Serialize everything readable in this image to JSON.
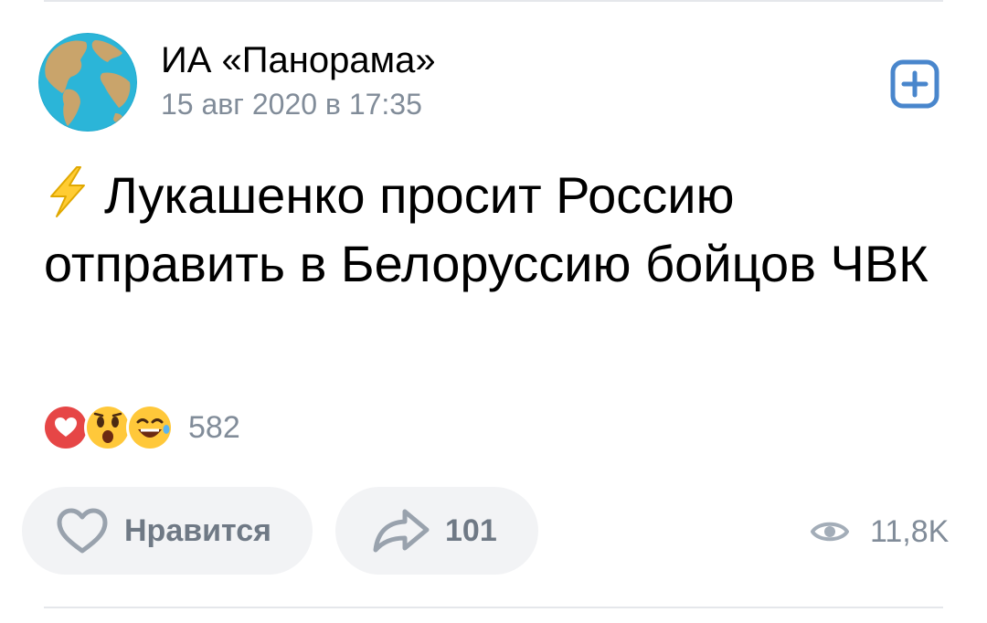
{
  "post": {
    "author": "ИА «Панорама»",
    "date": "15 авг 2020 в 17:35",
    "text": "Лукашенко просит Россию отправить в Белоруссию бойцов ЧВК",
    "text_prefix_icon": "lightning-icon"
  },
  "reactions": {
    "icons": [
      "heart-icon",
      "shocked-face-icon",
      "laughing-face-icon"
    ],
    "count": "582"
  },
  "actions": {
    "like_label": "Нравится",
    "share_count": "101"
  },
  "views": {
    "icon": "eye-icon",
    "count": "11,8K"
  },
  "colors": {
    "accent": "#4986cc",
    "secondary_text": "#818c99",
    "pill_background": "#f2f3f5"
  }
}
